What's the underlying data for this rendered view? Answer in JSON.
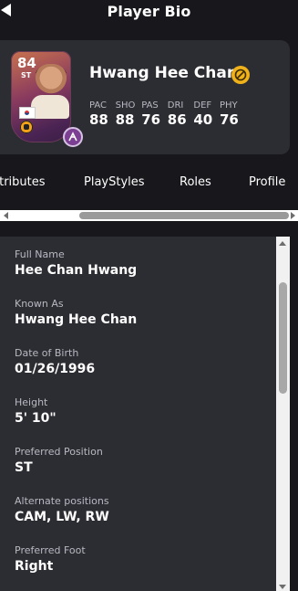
{
  "header": {
    "title": "Player Bio"
  },
  "player": {
    "name": "Hwang Hee Chan",
    "rating": "84",
    "position": "ST",
    "stats": [
      {
        "label": "PAC",
        "value": "88"
      },
      {
        "label": "SHO",
        "value": "88"
      },
      {
        "label": "PAS",
        "value": "76"
      },
      {
        "label": "DRI",
        "value": "86"
      },
      {
        "label": "DEF",
        "value": "40"
      },
      {
        "label": "PHY",
        "value": "76"
      }
    ]
  },
  "tabs": [
    {
      "label": "ttributes"
    },
    {
      "label": "PlayStyles"
    },
    {
      "label": "Roles"
    },
    {
      "label": "Profile"
    }
  ],
  "bio": [
    {
      "label": "Full Name",
      "value": "Hee Chan Hwang"
    },
    {
      "label": "Known As",
      "value": "Hwang Hee Chan"
    },
    {
      "label": "Date of Birth",
      "value": "01/26/1996"
    },
    {
      "label": "Height",
      "value": "5' 10\""
    },
    {
      "label": "Preferred Position",
      "value": "ST"
    },
    {
      "label": "Alternate positions",
      "value": "CAM, LW, RW"
    },
    {
      "label": "Preferred Foot",
      "value": "Right"
    }
  ],
  "colors": {
    "panel": "#2c2c33",
    "background": "#17171c",
    "accent": "#f0b21a",
    "evo": "#7b3f93"
  },
  "icons": [
    "back-arrow-icon",
    "no-chemistry-icon",
    "evolution-icon",
    "flag-icon",
    "club-crest-icon"
  ]
}
